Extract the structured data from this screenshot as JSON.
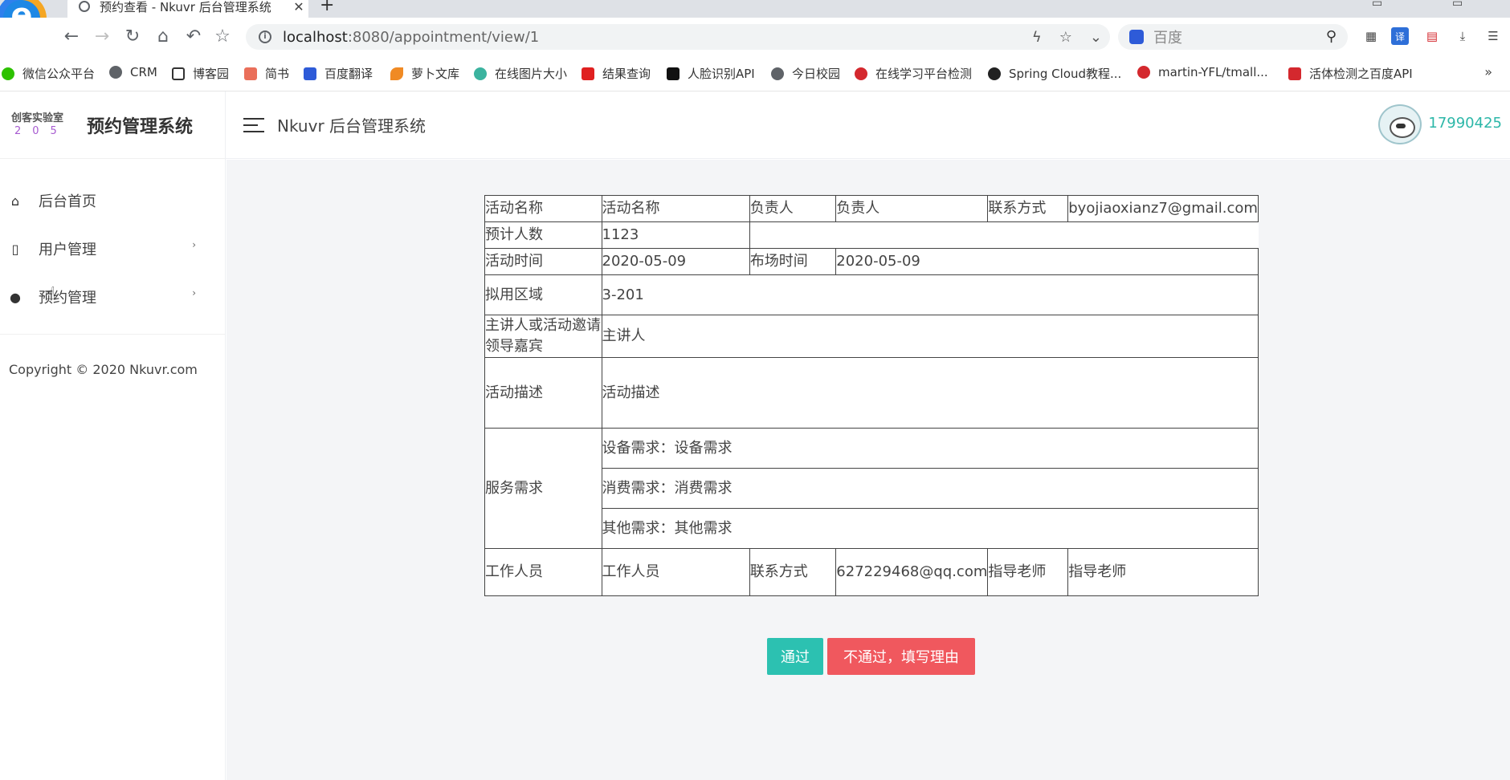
{
  "browser": {
    "tab_title": "预约查看 - Nkuvr 后台管理系统",
    "url_host": "localhost",
    "url_path": ":8080/appointment/view/1",
    "search_placeholder": "百度",
    "bookmarks": [
      {
        "label": "微信公众平台",
        "icon": "wechat-icon",
        "color": "#2dc100"
      },
      {
        "label": "CRM",
        "icon": "globe-icon",
        "color": "#5f6368"
      },
      {
        "label": "博客园",
        "icon": "cnblogs-icon",
        "color": "#333333"
      },
      {
        "label": "简书",
        "icon": "jianshu-icon",
        "color": "#ea6f5a"
      },
      {
        "label": "百度翻译",
        "icon": "baidu-translate-icon",
        "color": "#2e5bd8"
      },
      {
        "label": "萝卜文库",
        "icon": "carrot-icon",
        "color": "#f08a24"
      },
      {
        "label": "在线图片大小",
        "icon": "gear-icon",
        "color": "#3bb39f"
      },
      {
        "label": "结果查询",
        "icon": "five-icon",
        "color": "#e02020"
      },
      {
        "label": "人脸识别API",
        "icon": "ai-icon",
        "color": "#111111"
      },
      {
        "label": "今日校园",
        "icon": "globe-icon",
        "color": "#5f6368"
      },
      {
        "label": "在线学习平台检测",
        "icon": "g-icon",
        "color": "#d4282e"
      },
      {
        "label": "Spring Cloud教程...",
        "icon": "github-icon",
        "color": "#222222"
      },
      {
        "label": "martin-YFL/tmall...",
        "icon": "g-icon",
        "color": "#d4282e"
      },
      {
        "label": "活体检测之百度API",
        "icon": "c-icon",
        "color": "#d4282e"
      }
    ]
  },
  "sidebar": {
    "brand_mini_top": "创客实验室",
    "brand_mini_bottom": "205",
    "brand_name": "预约管理系统",
    "items": [
      {
        "label": "后台首页",
        "icon": "home-icon"
      },
      {
        "label": "用户管理",
        "icon": "file-icon"
      },
      {
        "label": "预约管理",
        "icon": "palette-icon"
      }
    ],
    "copyright": "Copyright © 2020 Nkuvr.com"
  },
  "header": {
    "title": "Nkuvr 后台管理系统",
    "username": "17990425"
  },
  "detail": {
    "activity_name_label": "活动名称",
    "activity_name": "活动名称",
    "owner_label": "负责人",
    "owner": "负责人",
    "contact_label": "联系方式",
    "contact": "byojiaoxianz7@gmail.com",
    "expected_count_label": "预计人数",
    "expected_count": "1123",
    "activity_time_label": "活动时间",
    "activity_time": "2020-05-09",
    "setup_time_label": "布场时间",
    "setup_time": "2020-05-09",
    "area_label": "拟用区域",
    "area": "3-201",
    "speaker_label": "主讲人或活动邀请领导嘉宾",
    "speaker": "主讲人",
    "description_label": "活动描述",
    "description": "活动描述",
    "service_label": "服务需求",
    "equipment": "设备需求：设备需求",
    "consumables": "消费需求：消费需求",
    "other": "其他需求：其他需求",
    "staff_label": "工作人员",
    "staff": "工作人员",
    "staff_contact_label": "联系方式",
    "staff_contact": "627229468@qq.com",
    "advisor_label": "指导老师",
    "advisor": "指导老师"
  },
  "actions": {
    "pass": "通过",
    "reject": "不通过，填写理由"
  },
  "colors": {
    "accent": "#2cc1b1",
    "danger": "#f0585e",
    "username": "#2cb7a8"
  }
}
